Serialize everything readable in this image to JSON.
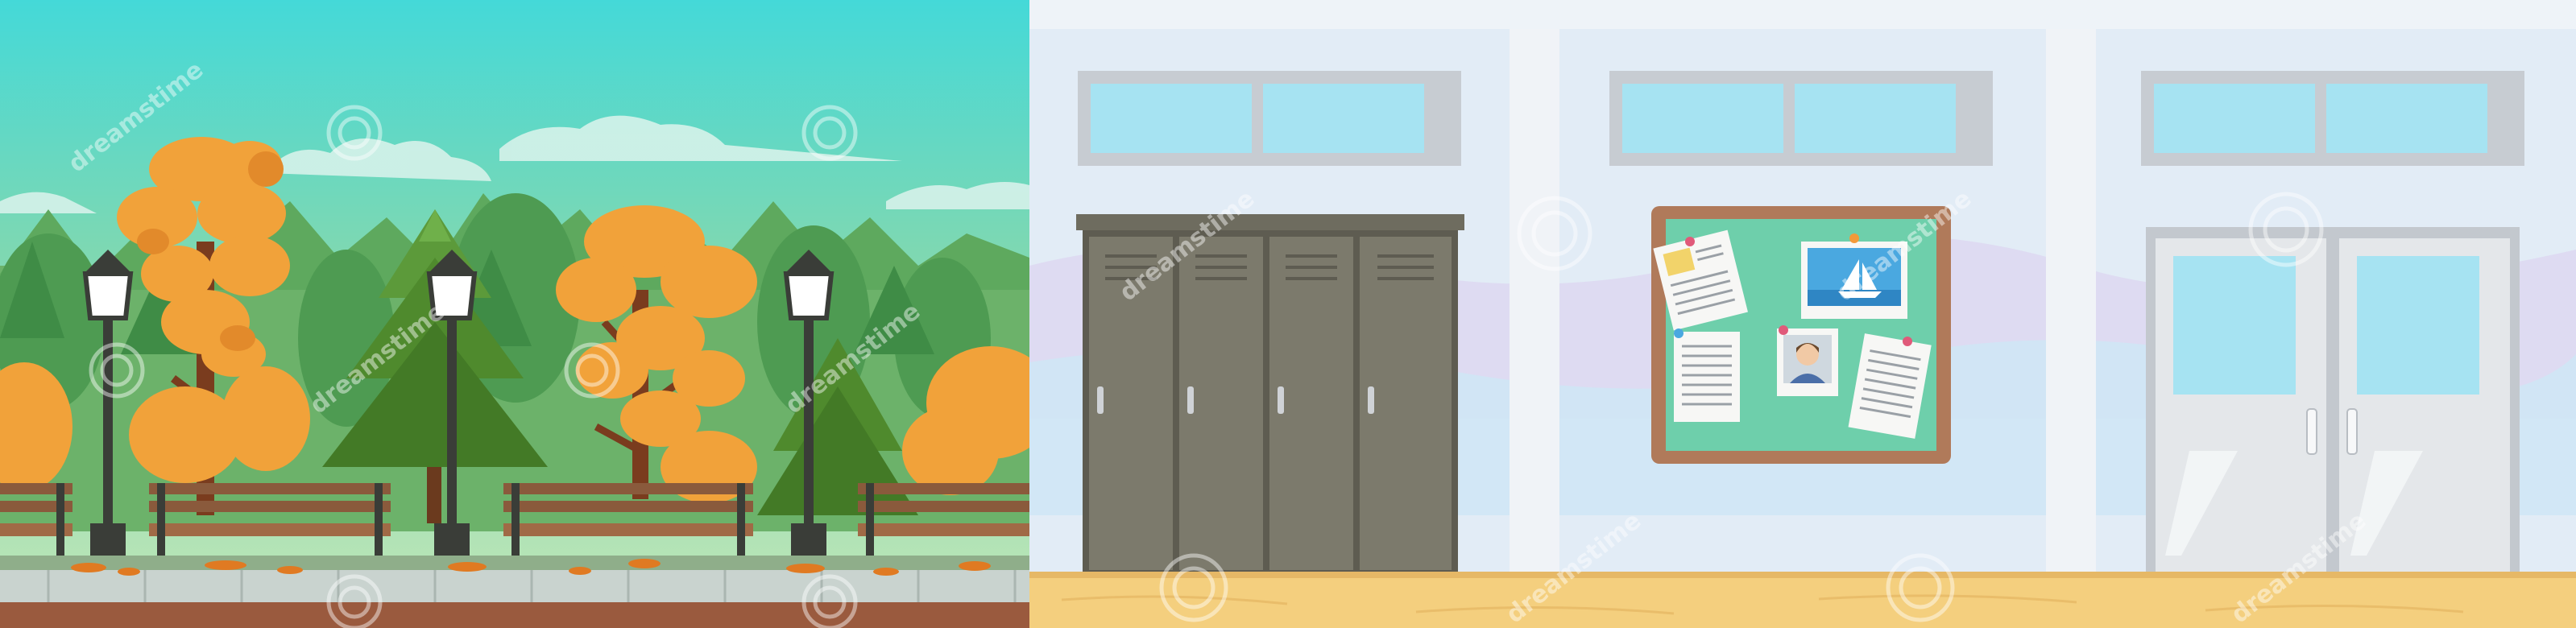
{
  "scenes": [
    {
      "name": "autumn park"
    },
    {
      "name": "school hallway"
    }
  ],
  "watermark": {
    "text": "dreamstime"
  },
  "colors": {
    "sky_top": "#44d9d8",
    "sky_bottom": "#b6e4b6",
    "autumn_orange": "#f1a23a",
    "pine_green": "#4f8a2d",
    "bench_brown": "#8a5a3c",
    "lamp_dark": "#3a3d38",
    "hall_wall": "#e2ecf6",
    "pillar": "#f0f3f7",
    "locker_gray": "#7c7a6c",
    "board_frame": "#b07a5a",
    "board_green": "#6ecfab",
    "window_blue": "#a6e3f2",
    "floor_wood": "#f4cf7e"
  }
}
